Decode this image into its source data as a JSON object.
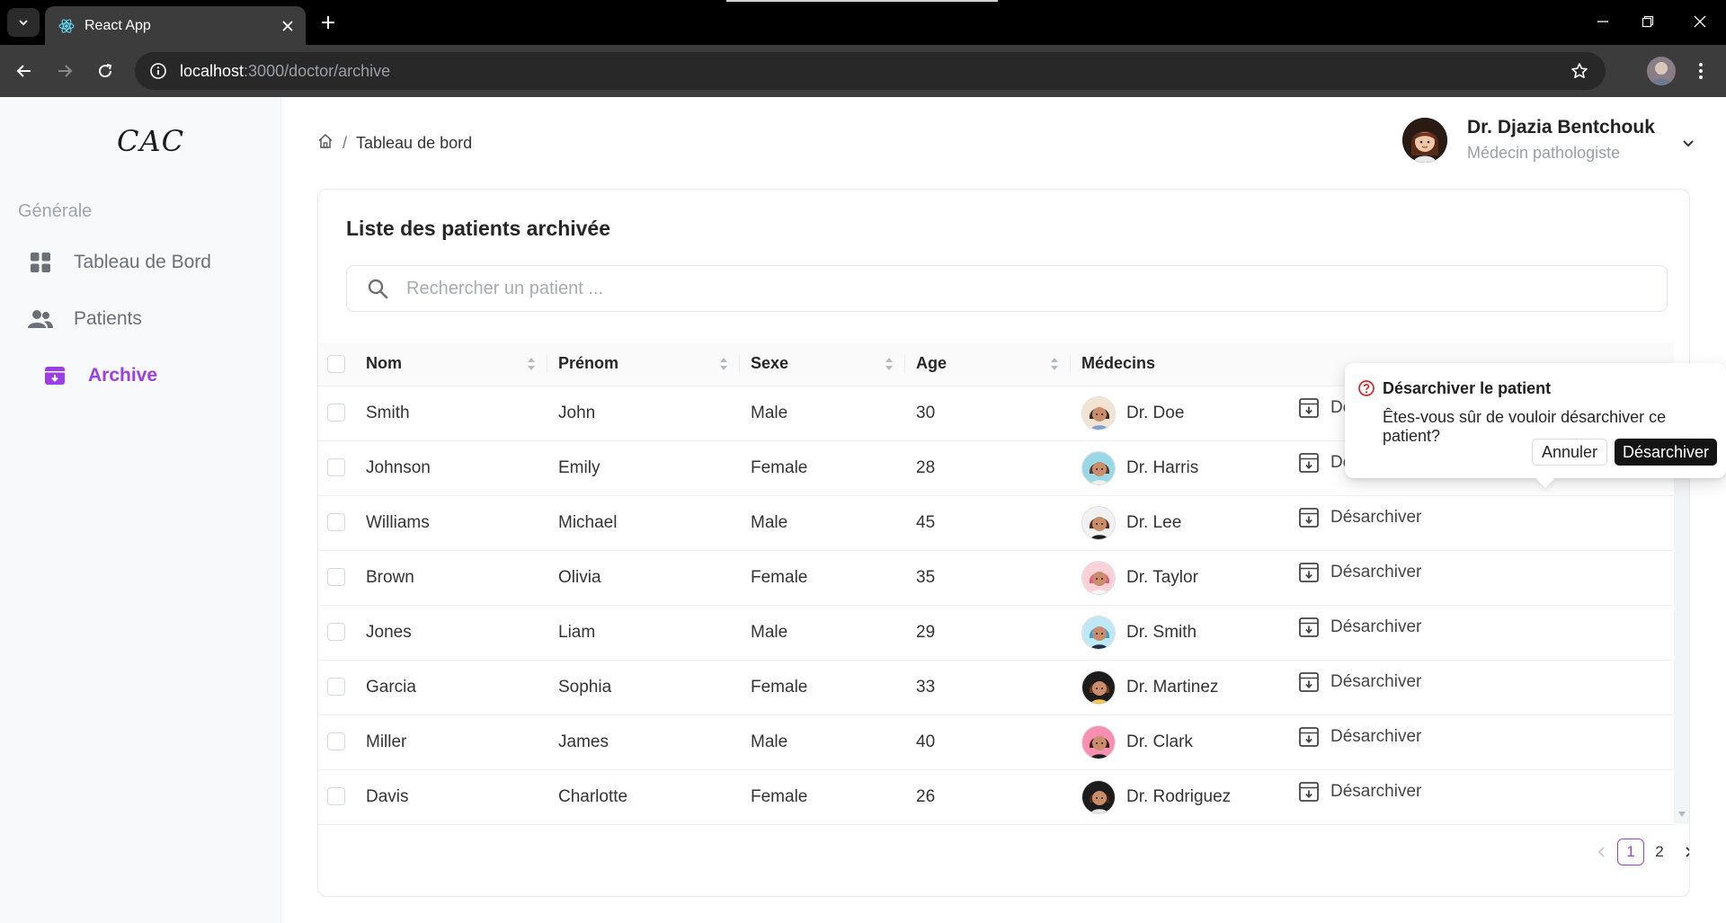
{
  "browser": {
    "tab_title": "React App",
    "url_host": "localhost",
    "url_path": ":3000/doctor/archive"
  },
  "sidebar": {
    "logo": "CAC",
    "section_title": "Générale",
    "items": [
      {
        "label": "Tableau de Bord",
        "icon": "dashboard-grid-icon"
      },
      {
        "label": "Patients",
        "icon": "users-icon"
      },
      {
        "label": "Archive",
        "icon": "archive-box-icon",
        "active": true
      }
    ],
    "accent_color": "#9b3ee6"
  },
  "header": {
    "breadcrumb": {
      "current": "Tableau de bord"
    },
    "user": {
      "name": "Dr. Djazia Bentchouk",
      "role": "Médecin pathologiste"
    }
  },
  "archive": {
    "title": "Liste des patients archivée",
    "search_placeholder": "Rechercher un patient ...",
    "columns": [
      "Nom",
      "Prénom",
      "Sexe",
      "Age",
      "Médecins"
    ],
    "action_label": "Désarchiver",
    "rows": [
      {
        "nom": "Smith",
        "prenom": "John",
        "sexe": "Male",
        "age": "30",
        "medecin": "Dr. Doe"
      },
      {
        "nom": "Johnson",
        "prenom": "Emily",
        "sexe": "Female",
        "age": "28",
        "medecin": "Dr. Harris"
      },
      {
        "nom": "Williams",
        "prenom": "Michael",
        "sexe": "Male",
        "age": "45",
        "medecin": "Dr. Lee"
      },
      {
        "nom": "Brown",
        "prenom": "Olivia",
        "sexe": "Female",
        "age": "35",
        "medecin": "Dr. Taylor"
      },
      {
        "nom": "Jones",
        "prenom": "Liam",
        "sexe": "Male",
        "age": "29",
        "medecin": "Dr. Smith"
      },
      {
        "nom": "Garcia",
        "prenom": "Sophia",
        "sexe": "Female",
        "age": "33",
        "medecin": "Dr. Martinez"
      },
      {
        "nom": "Miller",
        "prenom": "James",
        "sexe": "Male",
        "age": "40",
        "medecin": "Dr. Clark"
      },
      {
        "nom": "Davis",
        "prenom": "Charlotte",
        "sexe": "Female",
        "age": "26",
        "medecin": "Dr. Rodriguez"
      }
    ],
    "pagination": {
      "pages": [
        "1",
        "2"
      ],
      "current": "1"
    }
  },
  "popconfirm": {
    "title": "Désarchiver le patient",
    "description": "Êtes-vous sûr de vouloir désarchiver ce patient?",
    "cancel_label": "Annuler",
    "ok_label": "Désarchiver"
  }
}
